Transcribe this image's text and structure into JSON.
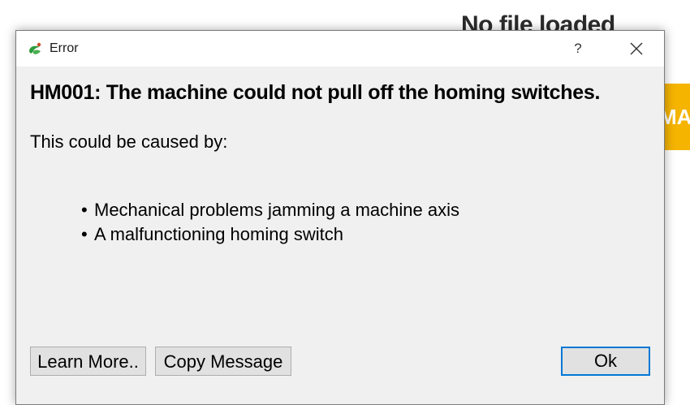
{
  "background": {
    "title": "No file loaded",
    "banner_text": "MA"
  },
  "dialog": {
    "title": "Error",
    "help_label": "?",
    "heading": "HM001: The machine could not pull off the homing switches.",
    "intro": "This could be caused by:",
    "bullet_glyph": "•",
    "causes": [
      "Mechanical problems jamming a machine axis",
      "A malfunctioning homing switch"
    ],
    "buttons": {
      "learn_more": "Learn More..",
      "copy_message": "Copy Message",
      "ok": "Ok"
    }
  },
  "colors": {
    "accent": "#0078d7",
    "banner": "#f5b400",
    "dialog_bg": "#f0f0f0",
    "icon_green": "#2e9a3c"
  },
  "icons": {
    "app": "app-logo-icon",
    "close": "close-icon"
  }
}
